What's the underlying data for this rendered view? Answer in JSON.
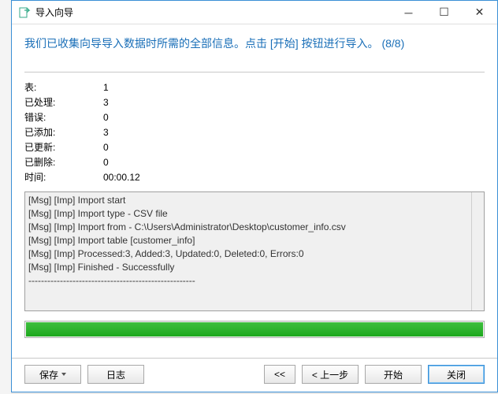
{
  "titlebar": {
    "title": "导入向导"
  },
  "headline": "我们已收集向导导入数据时所需的全部信息。点击 [开始] 按钮进行导入。 (8/8)",
  "stats": {
    "rows": [
      {
        "label": "表:",
        "value": "1"
      },
      {
        "label": "已处理:",
        "value": "3"
      },
      {
        "label": "错误:",
        "value": "0"
      },
      {
        "label": "已添加:",
        "value": "3"
      },
      {
        "label": "已更新:",
        "value": "0"
      },
      {
        "label": "已删除:",
        "value": "0"
      },
      {
        "label": "时间:",
        "value": "00:00.12"
      }
    ]
  },
  "log": {
    "lines": [
      "[Msg] [Imp] Import start",
      "[Msg] [Imp] Import type - CSV file",
      "[Msg] [Imp] Import from - C:\\Users\\Administrator\\Desktop\\customer_info.csv",
      "[Msg] [Imp] Import table [customer_info]",
      "[Msg] [Imp] Processed:3, Added:3, Updated:0, Deleted:0, Errors:0",
      "[Msg] [Imp] Finished - Successfully",
      "-----------------------------------------------------"
    ]
  },
  "progress": {
    "percent": 100
  },
  "buttons": {
    "save": "保存",
    "log": "日志",
    "first": "<<",
    "prev": "< 上一步",
    "start": "开始",
    "close": "关闭"
  }
}
